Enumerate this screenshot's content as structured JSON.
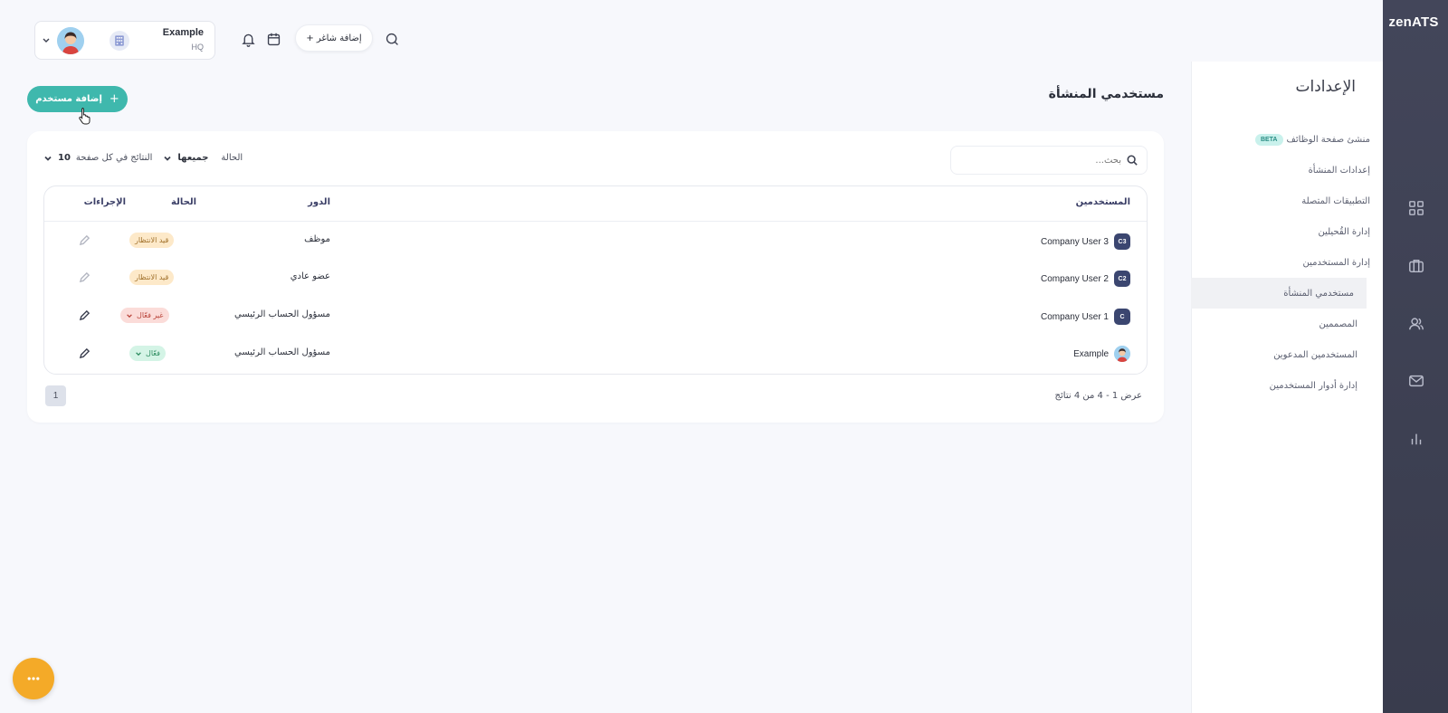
{
  "brand": {
    "logo_text_1": "zen",
    "logo_text_2": "ATS"
  },
  "header": {
    "org_name": "Example",
    "org_location": "HQ",
    "add_job_label": "+ إضافة شاغر"
  },
  "settings": {
    "title": "الإعدادات",
    "beta_label": "BETA",
    "items": [
      {
        "label": "منشئ صفحة الوظائف"
      },
      {
        "label": "إعدادات المنشأة"
      },
      {
        "label": "التطبيقات المتصلة"
      },
      {
        "label": "إدارة القُحيلين"
      },
      {
        "label": "إدارة المستخدمين"
      },
      {
        "label": "مستخدمي المنشأة"
      },
      {
        "label": "المصممين"
      },
      {
        "label": "المستخدمين المدعوين"
      },
      {
        "label": "إدارة أدوار المستخدمين"
      }
    ]
  },
  "main": {
    "page_title": "مستخدمي المنشأة",
    "add_user_label": "إضافة مستخدم",
    "search_placeholder": "بحث...",
    "filters": {
      "status_label": "الحالة",
      "status_value": "جميعها",
      "per_page_label": "النتائج في كل صفحة",
      "per_page_value": "10"
    },
    "table": {
      "headers": {
        "users": "المستخدمين",
        "role": "الدور",
        "status": "الحالة",
        "actions": "الإجراءات"
      },
      "rows": [
        {
          "initials": "C3",
          "name": "Company User 3",
          "role": "موظف",
          "status": "قيد الانتظار"
        },
        {
          "initials": "C2",
          "name": "Company User 2",
          "role": "عضو عادي",
          "status": "قيد الانتظار"
        },
        {
          "initials": "C",
          "name": "Company User 1",
          "role": "مسؤول الحساب الرئيسي",
          "status": "غير فعّال"
        },
        {
          "initials": "",
          "name": "Example",
          "role": "مسؤول الحساب الرئيسي",
          "status": "فعّال"
        }
      ]
    },
    "pagination": {
      "page": "1",
      "showing": "عرض 1 - 4 من 4 نتائج"
    }
  },
  "colors": {
    "accent": "#3fb8ad",
    "rail": "#3f4254",
    "fab": "#f4aa28"
  }
}
